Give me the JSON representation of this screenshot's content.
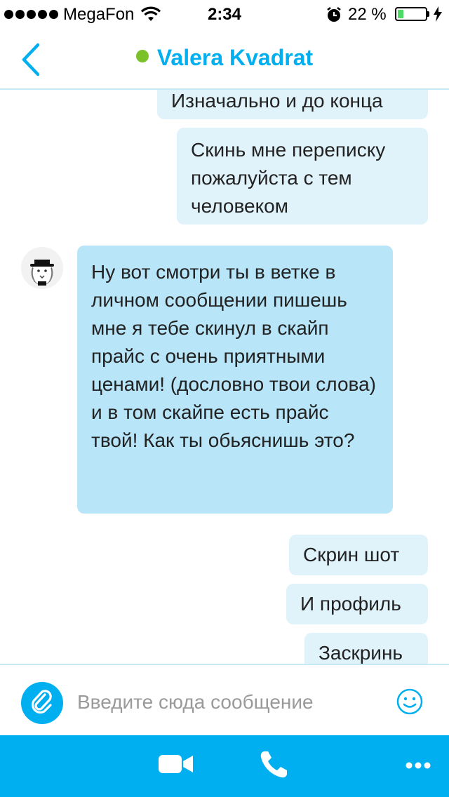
{
  "status_bar": {
    "carrier": "MegaFon",
    "time": "2:34",
    "battery_percent_text": "22 %",
    "battery_level": 0.22,
    "battery_color": "#4cd964"
  },
  "header": {
    "contact_name": "Valera Kvadrat",
    "online": true,
    "online_color": "#7ac12a",
    "accent_color": "#00aff0",
    "back_icon": "chevron-left-icon"
  },
  "messages": [
    {
      "direction": "outgoing",
      "text": "Изначально и до конца"
    },
    {
      "direction": "outgoing",
      "text": "Скинь мне переписку пожалуйста с тем человеком"
    },
    {
      "direction": "incoming",
      "text": "Ну вот смотри ты в ветке в личном сообщении пишешь мне я тебе скинул в скайп прайс с очень приятными ценами! (дословно твои слова) и в том скайпе есть прайс твой! Как ты обьяснишь это?"
    },
    {
      "direction": "outgoing",
      "text": "Скрин шот"
    },
    {
      "direction": "outgoing",
      "text": "И профиль"
    },
    {
      "direction": "outgoing",
      "text": "Заскринь"
    }
  ],
  "composer": {
    "placeholder": "Введите сюда сообщение",
    "value": "",
    "attach_icon": "paperclip-icon",
    "emoji_icon": "smiley-icon"
  },
  "toolbar": {
    "background": "#00aff0",
    "items": [
      "video-camera-icon",
      "phone-icon",
      "more-icon"
    ]
  }
}
